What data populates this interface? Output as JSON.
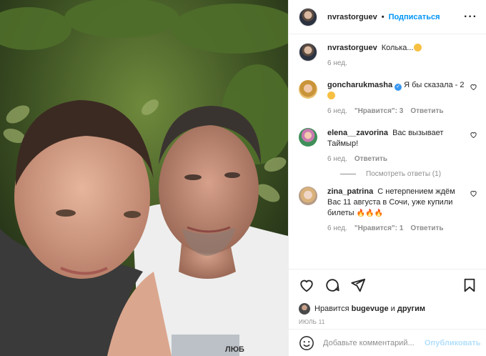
{
  "header": {
    "username": "nvrastorguev",
    "separator": "•",
    "follow_label": "Подписаться",
    "more_icon": "ellipsis-icon"
  },
  "caption": {
    "username": "nvrastorguev",
    "text": "Колька...",
    "time": "6 нед."
  },
  "comments": [
    {
      "username": "goncharukmasha",
      "verified": true,
      "text": "Я бы сказала - 2",
      "time": "6 нед.",
      "likes_label": "\"Нравится\": 3",
      "reply_label": "Ответить"
    },
    {
      "username": "elena__zavorina",
      "text": "Вас вызывает Таймыр!",
      "time": "6 нед.",
      "reply_label": "Ответить",
      "view_replies": "Посмотреть ответы (1)"
    },
    {
      "username": "zina_patrina",
      "text": "С нетерпением ждём Вас 11 августа в Сочи, уже купили билеты",
      "time": "6 нед.",
      "likes_label": "\"Нравится\": 1",
      "reply_label": "Ответить"
    }
  ],
  "likes": {
    "prefix": "Нравится",
    "user": "bugevuge",
    "conj": "и",
    "others": "другим"
  },
  "date": "ИЮЛЬ 11",
  "add_comment": {
    "placeholder": "Добавьте комментарий...",
    "publish_label": "Опубликовать"
  },
  "photo": {
    "shirt_text": "ЛЮБ"
  },
  "colors": {
    "link_blue": "#0095f6",
    "publish_disabled": "#b2dffc",
    "secondary_text": "#8e8e8e",
    "border": "#efefef"
  }
}
